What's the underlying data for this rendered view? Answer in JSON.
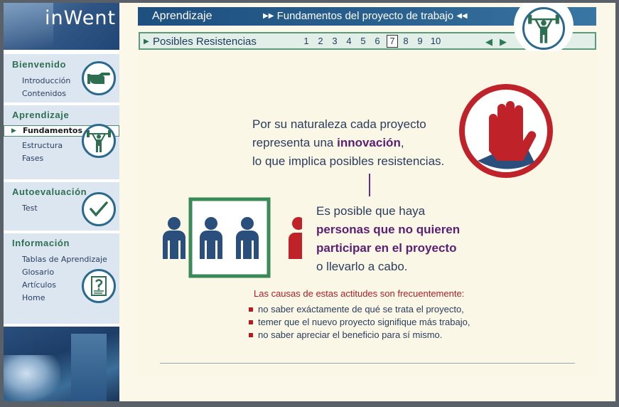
{
  "logo": {
    "text": "inWent"
  },
  "sidebar": {
    "sections": [
      {
        "title": "Bienvenido",
        "items": [
          "Introducción",
          "Contenidos"
        ],
        "icon": "pointing-hand-icon"
      },
      {
        "title": "Aprendizaje",
        "items": [
          "Fundamentos",
          "Estructura",
          "Fases"
        ],
        "active_item": "Fundamentos",
        "icon": "weightlifter-icon"
      },
      {
        "title": "Autoevaluación",
        "items": [
          "Test"
        ],
        "icon": "checkmark-icon"
      },
      {
        "title": "Información",
        "items": [
          "Tablas de Aprendizaje",
          "Glosario",
          "Artículos",
          "Home"
        ],
        "icon": "question-document-icon"
      }
    ]
  },
  "header": {
    "title": "Aprendizaje",
    "subtitle": "Fundamentos del proyecto de trabajo",
    "badge_icon": "weightlifter-icon"
  },
  "nav": {
    "label": "Posibles Resistencias",
    "pages": [
      "1",
      "2",
      "3",
      "4",
      "5",
      "6",
      "7",
      "8",
      "9",
      "10"
    ],
    "current_page": "7",
    "prev_icon": "prev-arrow-icon",
    "next_icon": "next-arrow-icon"
  },
  "content": {
    "para1": {
      "line1": "Por su naturaleza cada proyecto",
      "line2_pre": "representa una ",
      "line2_hl": "innovación",
      "line2_post": ",",
      "line3": "lo que implica posibles resistencias."
    },
    "para2": {
      "line1": "Es posible que haya",
      "line2_hl": "personas que no quieren",
      "line3_hl": "participar en el proyecto",
      "line4": "o llevarlo a cabo."
    },
    "causes_title": "Las causas de estas actitudes son frecuentemente:",
    "causes": [
      "no saber exáctamente de qué se trata el proyecto,",
      "temer que el nuevo proyecto signifique más trabajo,",
      "no saber apreciar el beneficio para sí mismo."
    ]
  },
  "colors": {
    "accent_green": "#2d6f50",
    "header_blue": "#1d4f7f",
    "highlight_purple": "#5b1f72",
    "alert_red": "#b01d24"
  }
}
